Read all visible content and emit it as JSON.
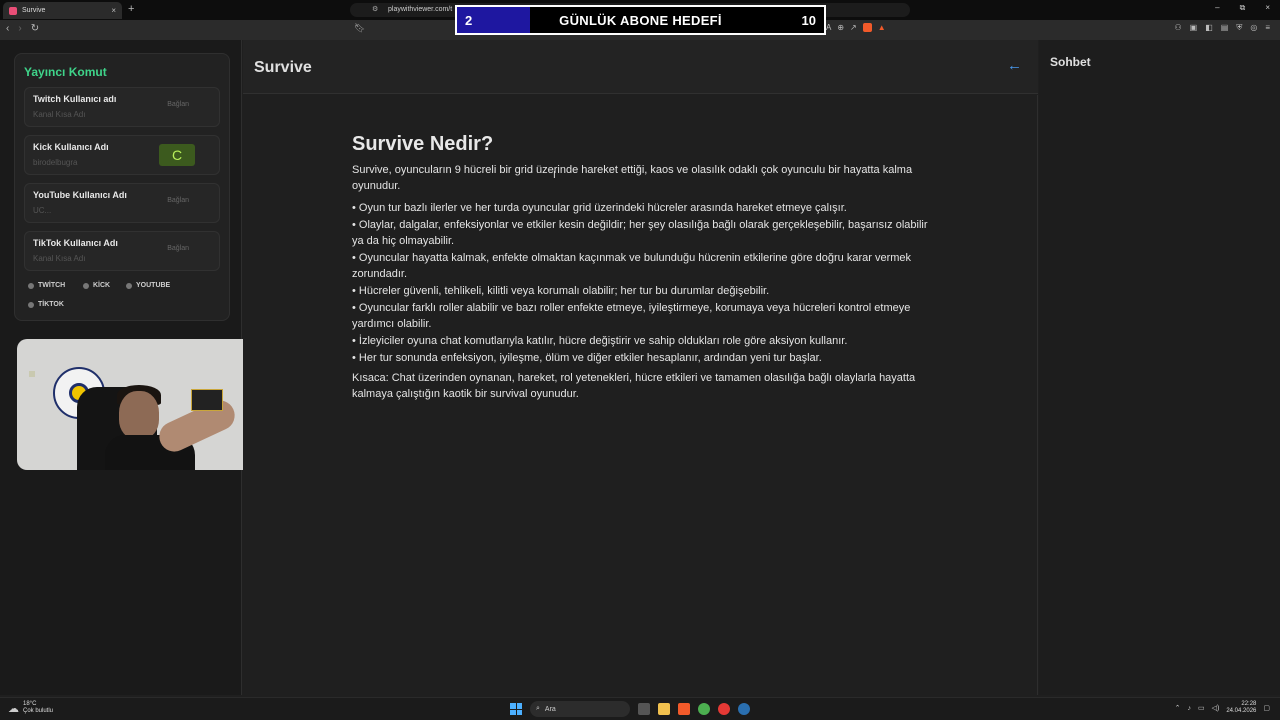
{
  "browser": {
    "tab_title": "Survive",
    "tab_close": "×",
    "new_tab": "+",
    "url": "playwithviewer.com/t",
    "window_controls": [
      "–",
      "⧉",
      "×"
    ]
  },
  "goal_overlay": {
    "current": "2",
    "title": "GÜNLÜK ABONE HEDEFİ",
    "target": "10",
    "progress_fraction": 0.2,
    "fill_color": "#1e17a0"
  },
  "left_panel": {
    "title": "Yayıncı Komut",
    "fields": [
      {
        "label": "Twitch Kullanıcı adı",
        "value": "Kanal Kısa Adı",
        "button": "Bağlan"
      },
      {
        "label": "Kick Kullanıcı Adı",
        "value": "birodelbugra",
        "button": "C"
      },
      {
        "label": "YouTube Kullanıcı Adı",
        "value": "UC...",
        "button": "Bağlan"
      },
      {
        "label": "TikTok Kullanıcı Adı",
        "value": "Kanal Kısa Adı",
        "button": "Bağlan"
      }
    ],
    "platforms": [
      "TWİTCH",
      "KİCK",
      "YOUTUBE",
      "TİKTOK"
    ]
  },
  "header": {
    "title": "Survive",
    "back_icon": "arrow-left-icon"
  },
  "article": {
    "heading": "Survive Nedir?",
    "intro": "Survive, oyuncuların 9 hücreli bir grid üzerinde hareket ettiği, kaos ve olasılık odaklı çok oyunculu bir hayatta kalma oyunudur.",
    "bullets": [
      "• Oyun tur bazlı ilerler ve her turda oyuncular grid üzerindeki hücreler arasında hareket etmeye çalışır.",
      "• Olaylar, dalgalar, enfeksiyonlar ve etkiler kesin değildir; her şey olasılığa bağlı olarak gerçekleşebilir, başarısız olabilir ya da hiç olmayabilir.",
      "• Oyuncular hayatta kalmak, enfekte olmaktan kaçınmak ve bulunduğu hücrenin etkilerine göre doğru karar vermek zorundadır.",
      "• Hücreler güvenli, tehlikeli, kilitli veya korumalı olabilir; her tur bu durumlar değişebilir.",
      "• Oyuncular farklı roller alabilir ve bazı roller enfekte etmeye, iyileştirmeye, korumaya veya hücreleri kontrol etmeye yardımcı olabilir.",
      "• İzleyiciler oyuna chat komutlarıyla katılır, hücre değiştirir ve sahip oldukları role göre aksiyon kullanır.",
      "• Her tur sonunda enfeksiyon, iyileşme, ölüm ve diğer etkiler hesaplanır, ardından yeni tur başlar."
    ],
    "summary": "Kısaca: Chat üzerinden oynanan, hareket, rol yetenekleri, hücre etkileri ve tamamen olasılığa bağlı olaylarla hayatta kalmaya çalıştığın kaotik bir survival oyunudur."
  },
  "chat": {
    "title": "Sohbet"
  },
  "taskbar": {
    "temperature": "18°C",
    "weather": "Çok bulutlu",
    "search_placeholder": "Ara",
    "time": "22:28",
    "date": "24.04.2026"
  }
}
